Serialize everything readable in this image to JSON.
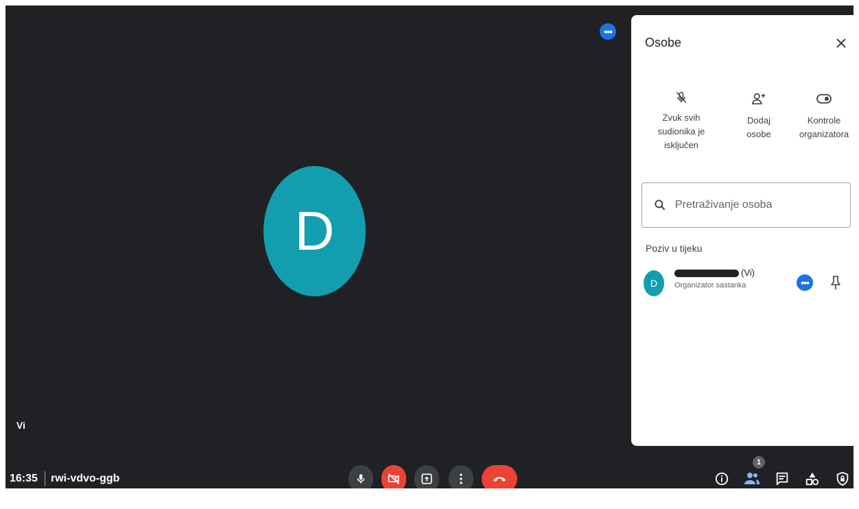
{
  "tile": {
    "avatar_letter": "D",
    "self_name": "Vi",
    "more_label": "•••"
  },
  "meeting": {
    "time": "16:35",
    "code": "rwi-vdvo-ggb"
  },
  "controls": {
    "mic_icon": "mic-icon",
    "camera_icon": "camera-off-icon",
    "present_icon": "present-icon",
    "more_icon": "more-vert-icon",
    "leave_icon": "call-end-icon"
  },
  "right_bar": {
    "people_badge": "1",
    "icons": [
      "info-icon",
      "people-icon",
      "chat-icon",
      "activities-icon",
      "host-controls-icon"
    ]
  },
  "panel": {
    "title": "Osobe",
    "actions": {
      "mute_all": {
        "line1": "Zvuk svih",
        "line2": "sudionika je",
        "line3": "isključen"
      },
      "add_people": {
        "line1": "Dodaj",
        "line2": "osobe"
      },
      "host_controls": {
        "line1": "Kontrole",
        "line2": "organizatora"
      }
    },
    "search": {
      "placeholder": "Pretraživanje osoba"
    },
    "section_label": "Poziv u tijeku",
    "participant": {
      "avatar_letter": "D",
      "name_suffix": "(Vi)",
      "role": "Organizator sastanka",
      "more_label": "•••"
    }
  },
  "colors": {
    "stage_bg": "#202124",
    "avatar": "#129eaf",
    "accent_blue": "#1a73e8",
    "leave_red": "#ea4335",
    "control_dark": "#3c4043"
  }
}
